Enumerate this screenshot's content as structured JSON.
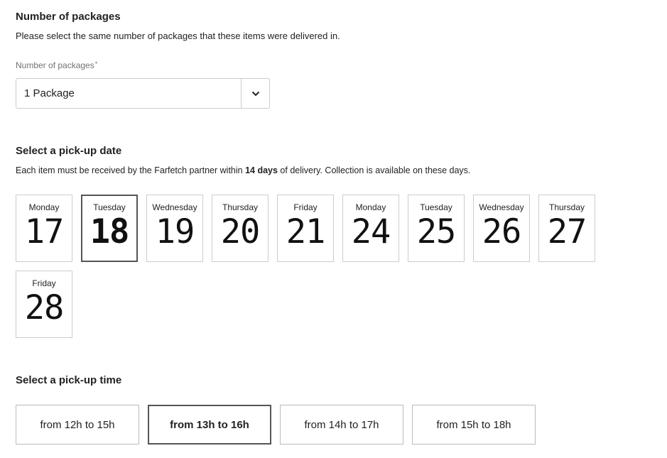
{
  "packages": {
    "title": "Number of packages",
    "description": "Please select the same number of packages that these items were delivered in.",
    "field_label": "Number of packages",
    "required_mark": "*",
    "selected_value": "1 Package",
    "arrow_icon": "chevron-down-icon"
  },
  "pickup_date": {
    "title": "Select a pick-up date",
    "desc_before": "Each item must be received by the Farfetch partner within ",
    "desc_bold": "14 days",
    "desc_after": " of delivery. Collection is available on these days.",
    "days": [
      {
        "weekday": "Monday",
        "day": "17",
        "selected": false
      },
      {
        "weekday": "Tuesday",
        "day": "18",
        "selected": true
      },
      {
        "weekday": "Wednesday",
        "day": "19",
        "selected": false
      },
      {
        "weekday": "Thursday",
        "day": "20",
        "selected": false
      },
      {
        "weekday": "Friday",
        "day": "21",
        "selected": false
      },
      {
        "weekday": "Monday",
        "day": "24",
        "selected": false
      },
      {
        "weekday": "Tuesday",
        "day": "25",
        "selected": false
      },
      {
        "weekday": "Wednesday",
        "day": "26",
        "selected": false
      },
      {
        "weekday": "Thursday",
        "day": "27",
        "selected": false
      },
      {
        "weekday": "Friday",
        "day": "28",
        "selected": false
      }
    ]
  },
  "pickup_time": {
    "title": "Select a pick-up time",
    "slots": [
      {
        "label": "from 12h to 15h",
        "selected": false
      },
      {
        "label": "from 13h to 16h",
        "selected": true
      },
      {
        "label": "from 14h to 17h",
        "selected": false
      },
      {
        "label": "from 15h to 18h",
        "selected": false
      }
    ]
  }
}
